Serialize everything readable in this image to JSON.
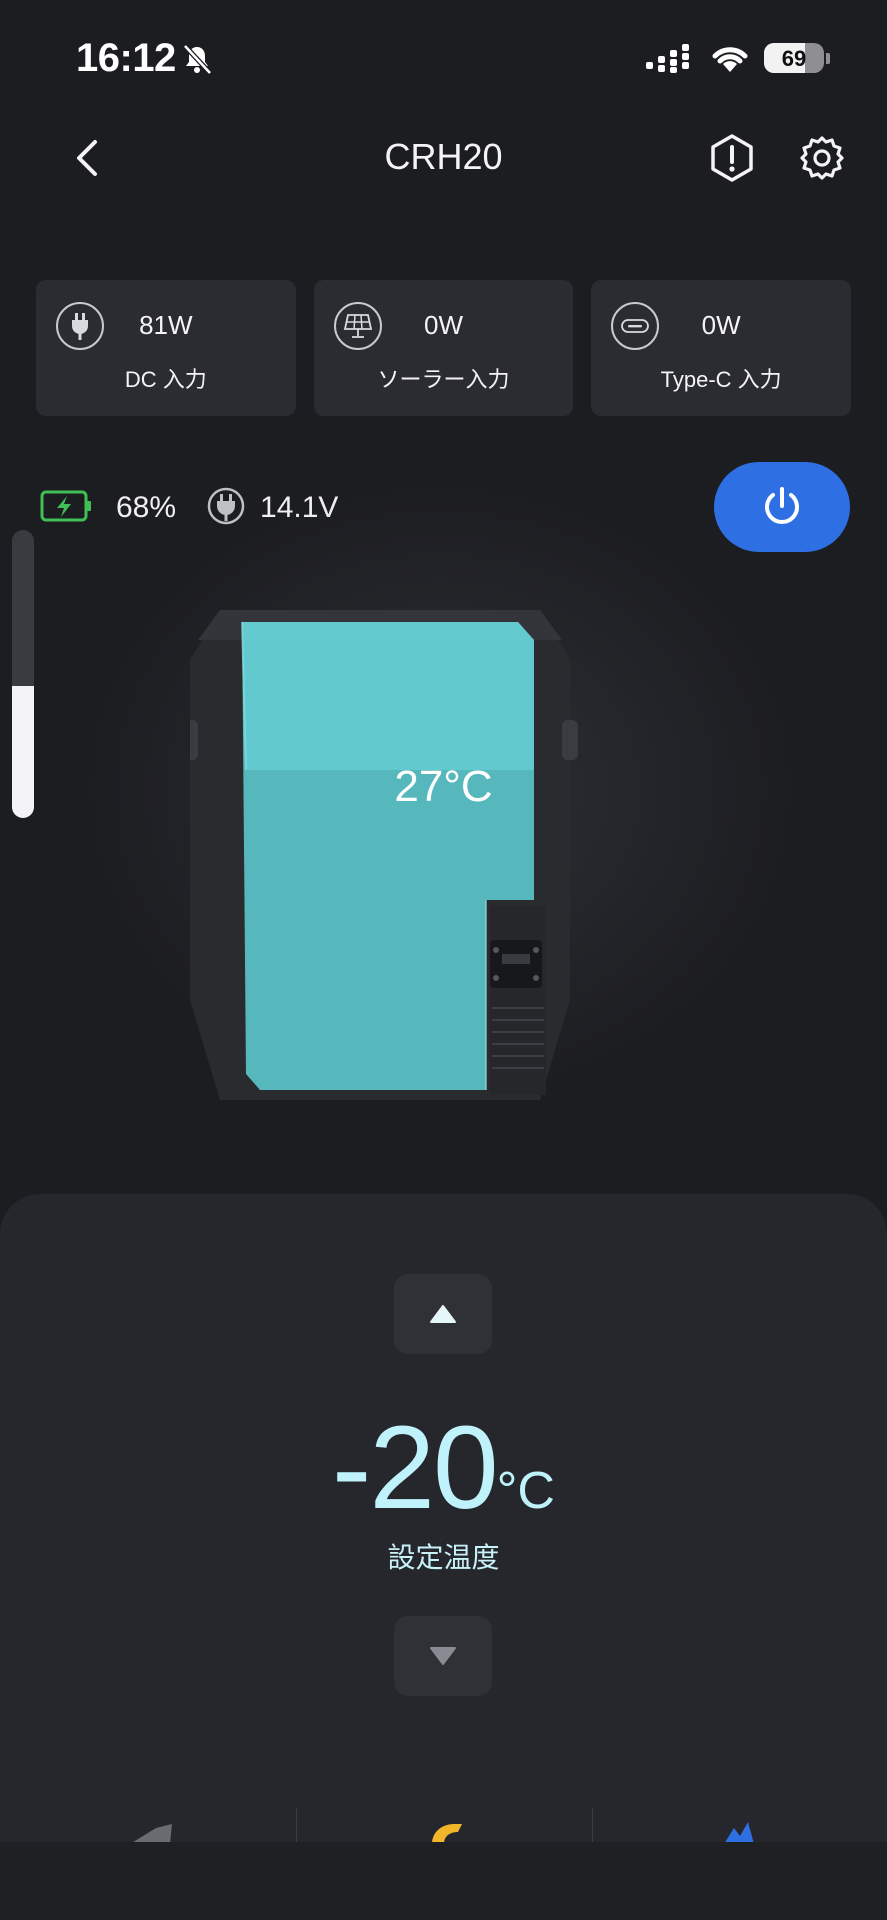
{
  "status_bar": {
    "time": "16:12",
    "battery_percent": "69",
    "battery_level": 0.69
  },
  "header": {
    "title": "CRH20"
  },
  "inputs": [
    {
      "value": "81W",
      "label": "DC 入力",
      "icon": "plug-icon"
    },
    {
      "value": "0W",
      "label": "ソーラー入力",
      "icon": "solar-panel-icon"
    },
    {
      "value": "0W",
      "label": "Type-C 入力",
      "icon": "usb-c-icon"
    }
  ],
  "battery": {
    "percent": "68%",
    "voltage": "14.1V"
  },
  "side_slider": {
    "level": 0.46
  },
  "fridge": {
    "current_temp": "27°C"
  },
  "setpoint": {
    "value": "-20",
    "unit": "°C",
    "label": "設定温度"
  },
  "colors": {
    "accent": "#2f6fe4",
    "cabin": "#5fc9cf",
    "setpoint_text": "#bff2fb",
    "battery_green": "#3fbf55"
  }
}
